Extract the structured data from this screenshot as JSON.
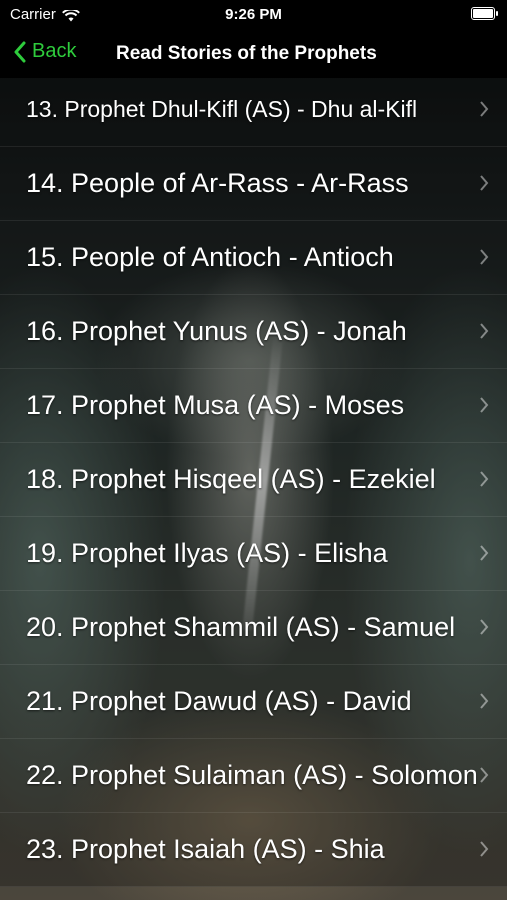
{
  "status_bar": {
    "carrier": "Carrier",
    "time": "9:26 PM"
  },
  "nav": {
    "back_label": "Back",
    "title": "Read Stories of the Prophets"
  },
  "list": {
    "items": [
      "13. Prophet Dhul-Kifl (AS) - Dhu al-Kifl",
      "14. People of Ar-Rass - Ar-Rass",
      "15. People of Antioch - Antioch",
      "16. Prophet Yunus (AS) - Jonah",
      "17. Prophet Musa (AS) - Moses",
      "18. Prophet Hisqeel (AS) - Ezekiel",
      "19. Prophet Ilyas (AS) - Elisha",
      "20. Prophet Shammil (AS) - Samuel",
      "21. Prophet Dawud (AS) - David",
      "22. Prophet Sulaiman (AS) - Solomon",
      "23. Prophet Isaiah (AS) - Shia"
    ]
  },
  "colors": {
    "accent": "#2ecc3c",
    "text": "#ffffff"
  },
  "icons": {
    "back": "chevron-left-icon",
    "row": "chevron-right-icon",
    "wifi": "wifi-icon",
    "battery": "battery-icon"
  }
}
